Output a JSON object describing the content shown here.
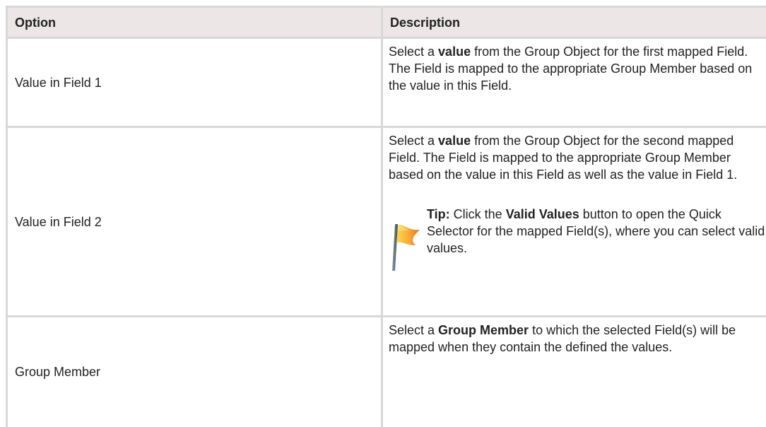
{
  "table": {
    "headers": {
      "option": "Option",
      "description": "Description"
    },
    "rows": [
      {
        "option": "Value in Field 1",
        "desc_part1": "Select a ",
        "desc_bold1": "value",
        "desc_part2": " from the Group Object for the first mapped Field. The Field is mapped to the appropriate Group Member based on the value in this Field."
      },
      {
        "option": "Value in Field 2",
        "desc_part1": "Select a ",
        "desc_bold1": "value",
        "desc_part2": " from the Group Object for the second mapped Field. The Field is mapped to the appropriate Group Member based on the value in this Field as well as the value in Field 1.",
        "tip": {
          "icon": "flag-icon",
          "label": "Tip:",
          "part1": " Click the ",
          "bold": "Valid Values",
          "part2": " button to open the Quick Selector for the mapped Field(s), where you can select valid values."
        }
      },
      {
        "option": "Group Member",
        "desc_part1": "Select a ",
        "desc_bold1": "Group Member",
        "desc_part2": " to which the selected Field(s) will be mapped when they contain the defined the values."
      }
    ]
  },
  "colors": {
    "header_bg": "#ece6e6",
    "border": "#d8d8d8",
    "flag_orange": "#f5a623",
    "flag_yellow": "#ffd54a",
    "flag_pole": "#5a6b78"
  }
}
